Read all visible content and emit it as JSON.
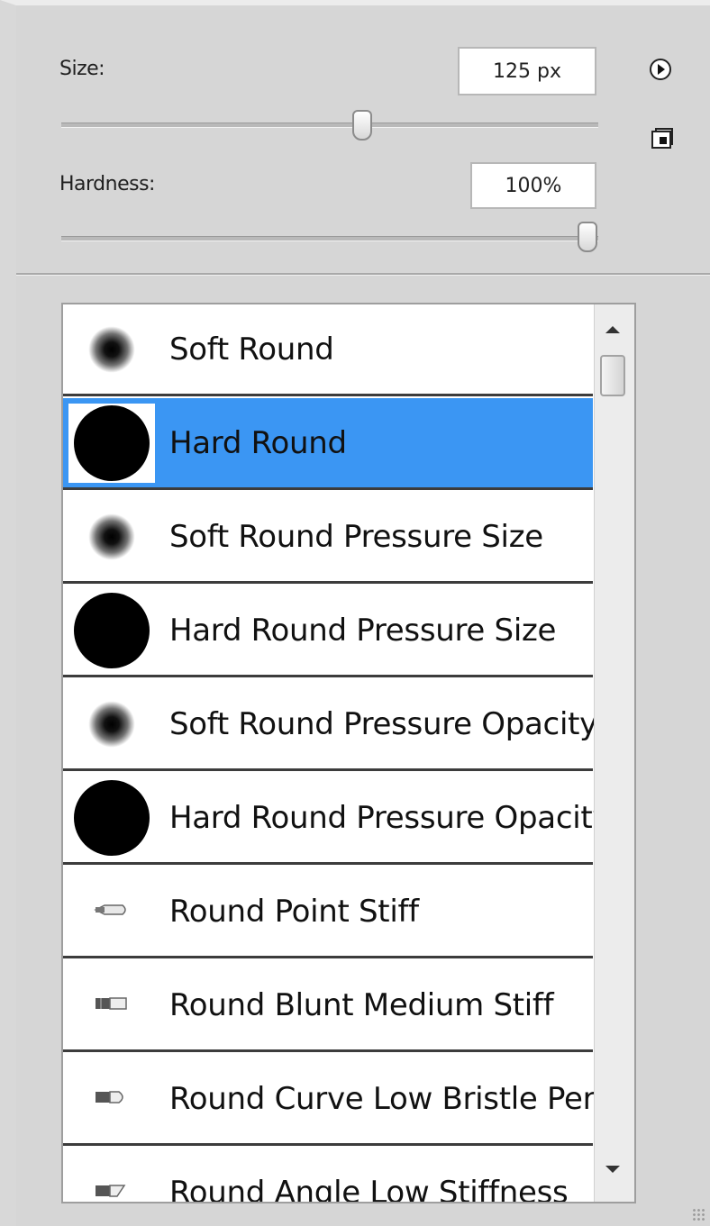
{
  "controls": {
    "size_label": "Size:",
    "size_value": "125 px",
    "size_fraction": 0.56,
    "hardness_label": "Hardness:",
    "hardness_value": "100%",
    "hardness_fraction": 1.0
  },
  "brushes": [
    {
      "name": "Soft Round",
      "tip": "soft",
      "selected": false
    },
    {
      "name": "Hard Round",
      "tip": "hard",
      "selected": true
    },
    {
      "name": "Soft Round Pressure Size",
      "tip": "soft",
      "selected": false
    },
    {
      "name": "Hard Round Pressure Size",
      "tip": "hard",
      "selected": false
    },
    {
      "name": "Soft Round Pressure Opacity",
      "tip": "soft",
      "selected": false
    },
    {
      "name": "Hard Round Pressure Opacity",
      "tip": "hard",
      "selected": false
    },
    {
      "name": "Round Point Stiff",
      "tip": "bristle-point",
      "selected": false
    },
    {
      "name": "Round Blunt Medium Stiff",
      "tip": "bristle-blunt",
      "selected": false
    },
    {
      "name": "Round Curve Low Bristle Percent",
      "tip": "bristle-curve",
      "selected": false
    },
    {
      "name": "Round Angle Low Stiffness",
      "tip": "bristle-angle",
      "selected": false
    }
  ],
  "icons": {
    "menu": "flyout-menu-icon",
    "new_preset": "new-preset-icon"
  },
  "colors": {
    "selection": "#3b96f3"
  }
}
